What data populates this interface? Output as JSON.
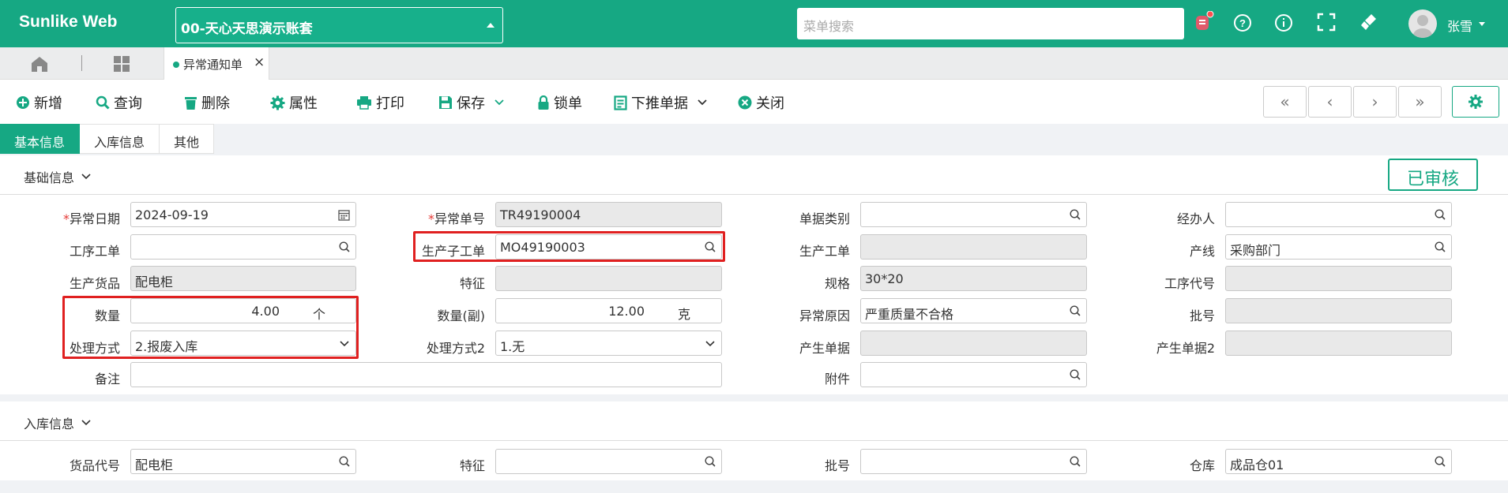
{
  "app": {
    "brand": "Sunlike Web",
    "account": "00-天心天思演示账套",
    "search_placeholder": "菜单搜索",
    "user": "张雪"
  },
  "tabs": {
    "page_tab": "异常通知单"
  },
  "toolbar": {
    "add": "新增",
    "query": "查询",
    "delete": "删除",
    "properties": "属性",
    "print": "打印",
    "save": "保存",
    "lock": "锁单",
    "push": "下推单据",
    "close": "关闭"
  },
  "section_tabs": [
    "基本信息",
    "入库信息",
    "其他"
  ],
  "status": "已审核",
  "basic": {
    "title": "基础信息",
    "fields": {
      "exception_date": {
        "label": "异常日期",
        "value": "2024-09-19"
      },
      "exception_no": {
        "label": "异常单号",
        "value": "TR49190004"
      },
      "doc_type": {
        "label": "单据类别",
        "value": ""
      },
      "handler": {
        "label": "经办人",
        "value": ""
      },
      "process_order": {
        "label": "工序工单",
        "value": ""
      },
      "sub_order": {
        "label": "生产子工单",
        "value": "MO49190003"
      },
      "prod_order": {
        "label": "生产工单",
        "value": ""
      },
      "line": {
        "label": "产线",
        "value": "采购部门"
      },
      "product": {
        "label": "生产货品",
        "value": "配电柜"
      },
      "feature": {
        "label": "特征",
        "value": ""
      },
      "spec": {
        "label": "规格",
        "value": "30*20"
      },
      "process_code": {
        "label": "工序代号",
        "value": ""
      },
      "qty": {
        "label": "数量",
        "value": "4.00",
        "unit": "个"
      },
      "qty2": {
        "label": "数量(副)",
        "value": "12.00",
        "unit": "克"
      },
      "reason": {
        "label": "异常原因",
        "value": "严重质量不合格"
      },
      "batch": {
        "label": "批号",
        "value": ""
      },
      "method": {
        "label": "处理方式",
        "value": "2.报废入库"
      },
      "method2": {
        "label": "处理方式2",
        "value": "1.无"
      },
      "src_doc": {
        "label": "产生单据",
        "value": ""
      },
      "src_doc2": {
        "label": "产生单据2",
        "value": ""
      },
      "remark": {
        "label": "备注",
        "value": ""
      },
      "attachment": {
        "label": "附件",
        "value": ""
      }
    }
  },
  "storage": {
    "title": "入库信息",
    "fields": {
      "item_code": {
        "label": "货品代号",
        "value": "配电柜"
      },
      "feature": {
        "label": "特征",
        "value": ""
      },
      "batch": {
        "label": "批号",
        "value": ""
      },
      "warehouse": {
        "label": "仓库",
        "value": "成品仓01"
      }
    }
  },
  "colors": {
    "accent": "#16a883",
    "highlight": "#e02020"
  }
}
